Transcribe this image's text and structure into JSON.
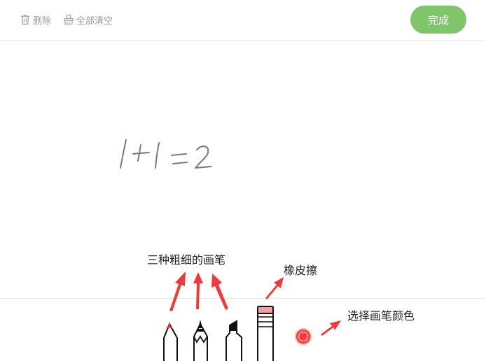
{
  "toolbar_top": {
    "delete_label": "删除",
    "clear_all_label": "全部清空",
    "done_label": "完成"
  },
  "colors": {
    "done_button": "#7fc66a",
    "selected_pen_color": "#ff3b3b",
    "eraser_tip": "#f4a0a0",
    "annotation_arrow": "#f03a3a"
  },
  "annotations": {
    "pens": "三种粗细的画笔",
    "eraser": "橡皮擦",
    "color": "选择画笔颜色"
  },
  "tools": [
    "pencil-thin",
    "pen-medium",
    "marker-thick",
    "eraser",
    "color-picker"
  ]
}
